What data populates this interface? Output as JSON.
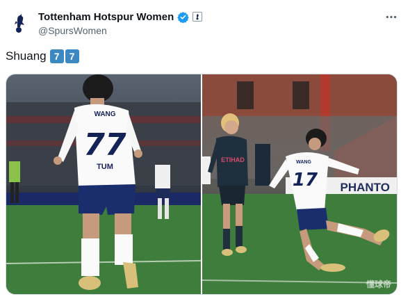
{
  "account": {
    "display_name": "Tottenham Hotspur Women",
    "handle": "@SpursWomen",
    "avatar_icon": "spurs-cockerel-crest-icon",
    "verified_icon": "verified-check-icon",
    "verified_color": "#1d9bf0",
    "affiliate_badge_icon": "club-crest-badge-icon"
  },
  "actions": {
    "more_icon": "more-dots-icon"
  },
  "tweet": {
    "text": "Shuang",
    "emoji": [
      "7",
      "7"
    ],
    "emoji_color": "#3b88c3"
  },
  "media": {
    "photos": [
      {
        "name_on_shirt": "WANG",
        "number_on_shirt": "77",
        "sponsor_on_shirt": "TUM"
      },
      {
        "name_on_shirt": "WANG",
        "number_on_shirt": "17",
        "opponent_sponsor": "ETIHAD",
        "board_text": "PHANTO"
      }
    ],
    "watermark": "懂球帝"
  },
  "colors": {
    "text": "#0f1419",
    "secondary": "#536471",
    "pitch": "#3f7d3c",
    "spurs_navy": "#132257"
  }
}
